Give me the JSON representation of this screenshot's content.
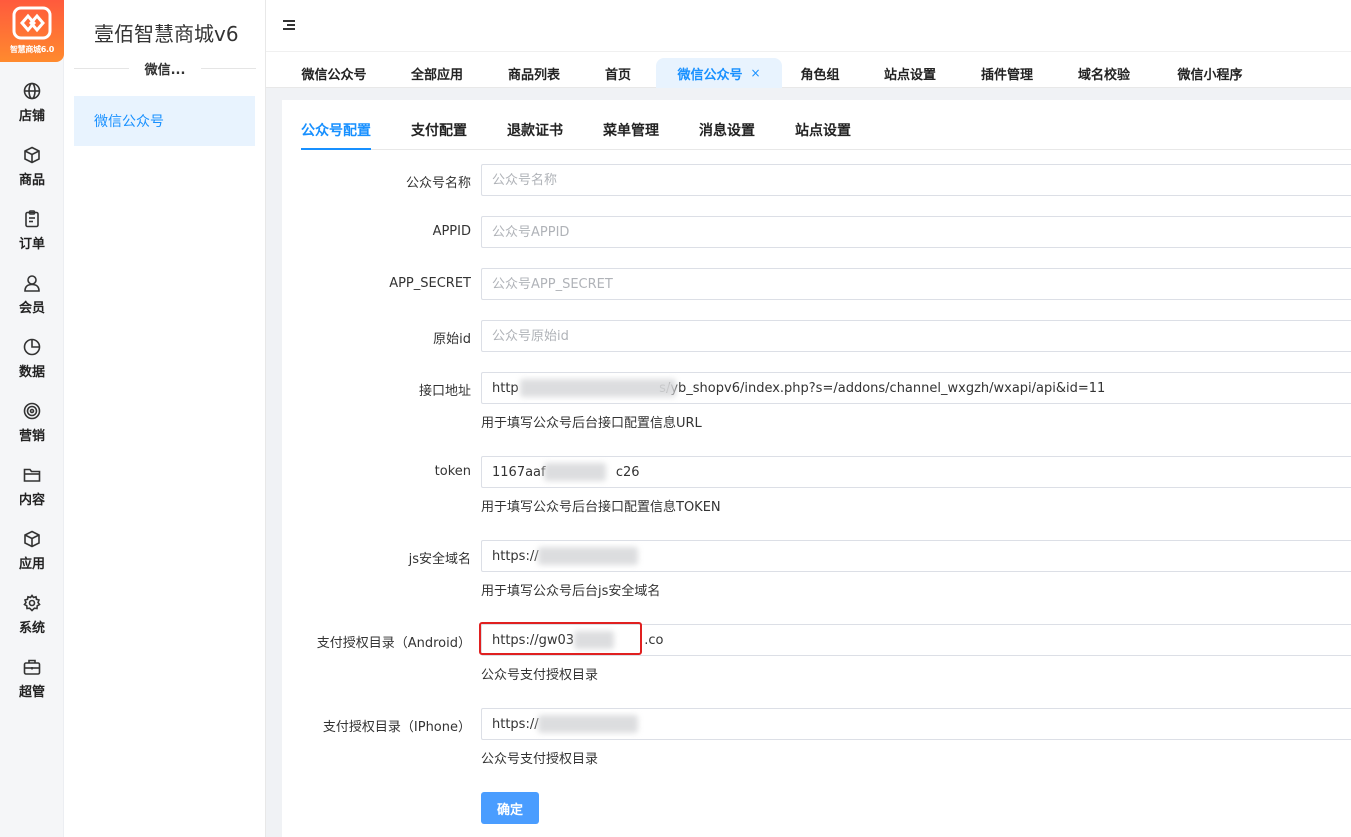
{
  "brand": {
    "logo_text": "智慧商城6.0",
    "accent": "#1890ff",
    "logo_gradient": [
      "#ff5a3d",
      "#ff8a2e"
    ]
  },
  "rail": [
    {
      "label": "店铺",
      "icon": "globe-icon"
    },
    {
      "label": "商品",
      "icon": "cube-icon"
    },
    {
      "label": "订单",
      "icon": "clipboard-icon"
    },
    {
      "label": "会员",
      "icon": "user-icon"
    },
    {
      "label": "数据",
      "icon": "pie-chart-icon"
    },
    {
      "label": "营销",
      "icon": "target-icon"
    },
    {
      "label": "内容",
      "icon": "folder-icon"
    },
    {
      "label": "应用",
      "icon": "box-icon"
    },
    {
      "label": "系统",
      "icon": "gear-icon"
    },
    {
      "label": "超管",
      "icon": "briefcase-icon"
    }
  ],
  "sidebar": {
    "store_name": "壹佰智慧商城v6",
    "group_title": "微信...",
    "active_item": "微信公众号"
  },
  "tabs": [
    {
      "label": "微信公众号"
    },
    {
      "label": "全部应用"
    },
    {
      "label": "商品列表"
    },
    {
      "label": "首页"
    },
    {
      "label": "微信公众号",
      "active": true,
      "close": "×"
    },
    {
      "label": "角色组"
    },
    {
      "label": "站点设置"
    },
    {
      "label": "插件管理"
    },
    {
      "label": "域名校验"
    },
    {
      "label": "微信小程序"
    }
  ],
  "subtabs": [
    "公众号配置",
    "支付配置",
    "退款证书",
    "菜单管理",
    "消息设置",
    "站点设置"
  ],
  "form": {
    "fields": [
      {
        "label": "公众号名称",
        "value": "",
        "placeholder": "公众号名称",
        "hint": ""
      },
      {
        "label": "APPID",
        "value": "",
        "placeholder": "公众号APPID",
        "hint": ""
      },
      {
        "label": "APP_SECRET",
        "value": "",
        "placeholder": "公众号APP_SECRET",
        "hint": ""
      },
      {
        "label": "原始id",
        "value": "",
        "placeholder": "公众号原始id",
        "hint": ""
      },
      {
        "label": "接口地址",
        "value": "http                                  s/yb_shopv6/index.php?s=/addons/channel_wxgzh/wxapi/api&id=11",
        "placeholder": "",
        "hint": "用于填写公众号后台接口配置信息URL"
      },
      {
        "label": "token",
        "value": "1167aaf                 c26",
        "placeholder": "",
        "hint": "用于填写公众号后台接口配置信息TOKEN"
      },
      {
        "label": "js安全域名",
        "value": "https://",
        "placeholder": "",
        "hint": "用于填写公众号后台js安全域名"
      },
      {
        "label": "支付授权目录（Android）",
        "value": "https://gw03                 .co",
        "placeholder": "",
        "hint": "公众号支付授权目录"
      },
      {
        "label": "支付授权目录（IPhone）",
        "value": "https://",
        "placeholder": "",
        "hint": "公众号支付授权目录"
      }
    ],
    "submit_label": "确定"
  }
}
